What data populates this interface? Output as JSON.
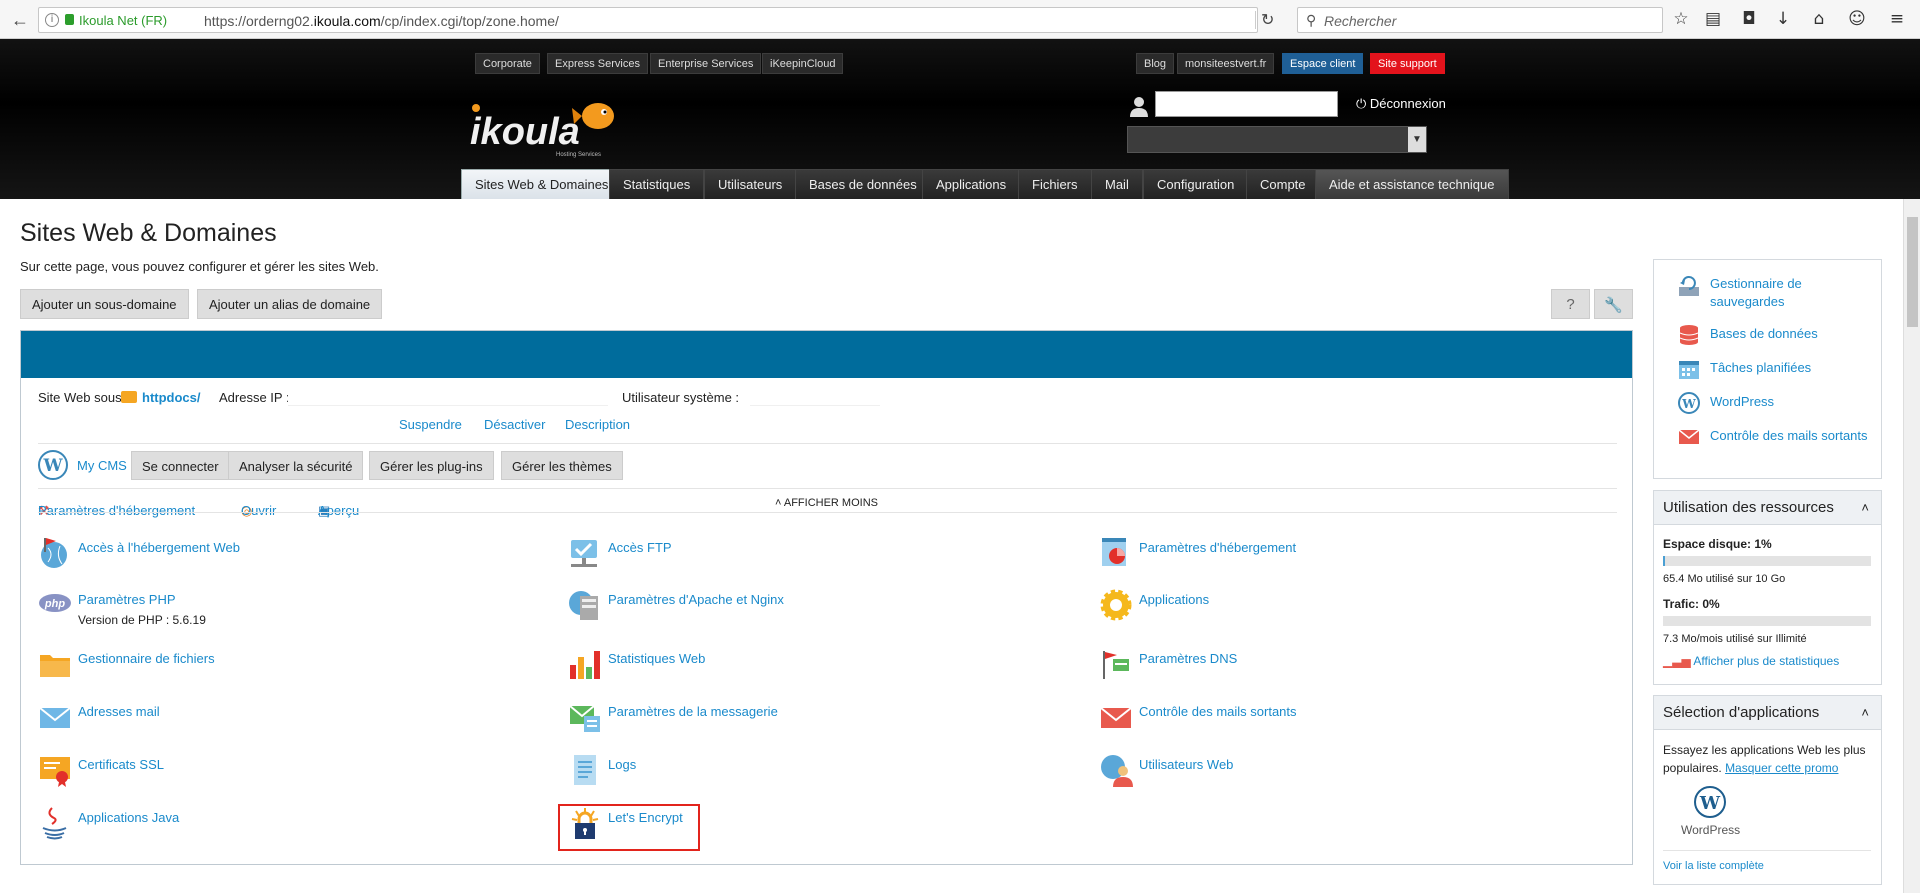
{
  "browser": {
    "site_identity": "Ikoula Net (FR)",
    "url_prefix": "https://orderng02.",
    "url_domain": "ikoula.com",
    "url_path": "/cp/index.cgi/top/zone.home/",
    "search_placeholder": "Rechercher"
  },
  "header": {
    "left_links": [
      "Corporate",
      "Express Services",
      "Enterprise Services",
      "iKeepinCloud"
    ],
    "right_links": [
      "Blog",
      "monsiteestvert.fr",
      "Espace client",
      "Site support"
    ],
    "logo_text": "ikoula",
    "logo_tagline": "Hosting Services",
    "logout_label": "Déconnexion",
    "main_tabs": [
      "Sites Web & Domaines",
      "Statistiques",
      "Utilisateurs",
      "Bases de données",
      "Applications",
      "Fichiers",
      "Mail",
      "Configuration",
      "Compte",
      "Aide et assistance technique"
    ]
  },
  "page": {
    "title": "Sites Web & Domaines",
    "subtitle": "Sur cette page, vous pouvez configurer et gérer les sites Web.",
    "add_subdomain": "Ajouter un sous-domaine",
    "add_alias": "Ajouter un alias de domaine",
    "help_glyph": "?",
    "show_less": "AFFICHER MOINS"
  },
  "site": {
    "site_under_label": "Site Web sous",
    "folder": "httpdocs/",
    "ip_label": "Adresse IP :",
    "sys_user_label": "Utilisateur système :",
    "actions": [
      "Paramètres d'hébergement",
      "Ouvrir",
      "Aperçu",
      "Suspendre",
      "Désactiver",
      "Description"
    ],
    "cms_label": "My CMS",
    "cms_buttons": [
      "Se connecter",
      "Analyser la sécurité",
      "Gérer les plug-ins",
      "Gérer les thèmes"
    ]
  },
  "tools": [
    {
      "label": "Accès à l'hébergement Web",
      "icon": "globe-flag-icon"
    },
    {
      "label": "Accès FTP",
      "icon": "ftp-icon"
    },
    {
      "label": "Paramètres d'hébergement",
      "icon": "hosting-settings-icon"
    },
    {
      "label": "Paramètres PHP",
      "sub": "Version de PHP : 5.6.19",
      "icon": "php-icon"
    },
    {
      "label": "Paramètres d'Apache et Nginx",
      "icon": "web-server-icon"
    },
    {
      "label": "Applications",
      "icon": "applications-gear-icon"
    },
    {
      "label": "Gestionnaire de fichiers",
      "icon": "folder-icon"
    },
    {
      "label": "Statistiques Web",
      "icon": "bar-chart-icon"
    },
    {
      "label": "Paramètres DNS",
      "icon": "dns-icon"
    },
    {
      "label": "Adresses mail",
      "icon": "mail-icon"
    },
    {
      "label": "Paramètres de la messagerie",
      "icon": "mail-settings-icon"
    },
    {
      "label": "Contrôle des mails sortants",
      "icon": "mail-red-icon"
    },
    {
      "label": "Certificats SSL",
      "icon": "certificate-icon"
    },
    {
      "label": "Logs",
      "icon": "logs-icon"
    },
    {
      "label": "Utilisateurs Web",
      "icon": "web-users-icon"
    },
    {
      "label": "Applications Java",
      "icon": "java-icon"
    },
    {
      "label": "Let's Encrypt",
      "icon": "lets-encrypt-icon"
    }
  ],
  "sidebar": {
    "quick_links": [
      "Gestionnaire de sauvegardes",
      "Bases de données",
      "Tâches planifiées",
      "WordPress",
      "Contrôle des mails sortants"
    ],
    "resources": {
      "title": "Utilisation des ressources",
      "disk_label": "Espace disque: 1%",
      "disk_fraction": 0.01,
      "disk_detail": "65.4 Mo utilisé sur 10 Go",
      "traffic_label": "Trafic: 0%",
      "traffic_fraction": 0.0,
      "traffic_detail": "7.3 Mo/mois utilisé sur Illimité",
      "more_stats": "Afficher plus de statistiques"
    },
    "apps": {
      "title": "Sélection d'applications",
      "text": "Essayez les applications Web les plus populaires.",
      "hide_promo": "Masquer cette promo",
      "app_name": "WordPress",
      "full_list": "Voir la liste complète"
    }
  },
  "colors": {
    "accent_blue": "#006c9c",
    "link": "#1a8acb",
    "support_red": "#e3131c",
    "client_blue": "#1f5f96",
    "highlight_red": "#e2241c"
  }
}
